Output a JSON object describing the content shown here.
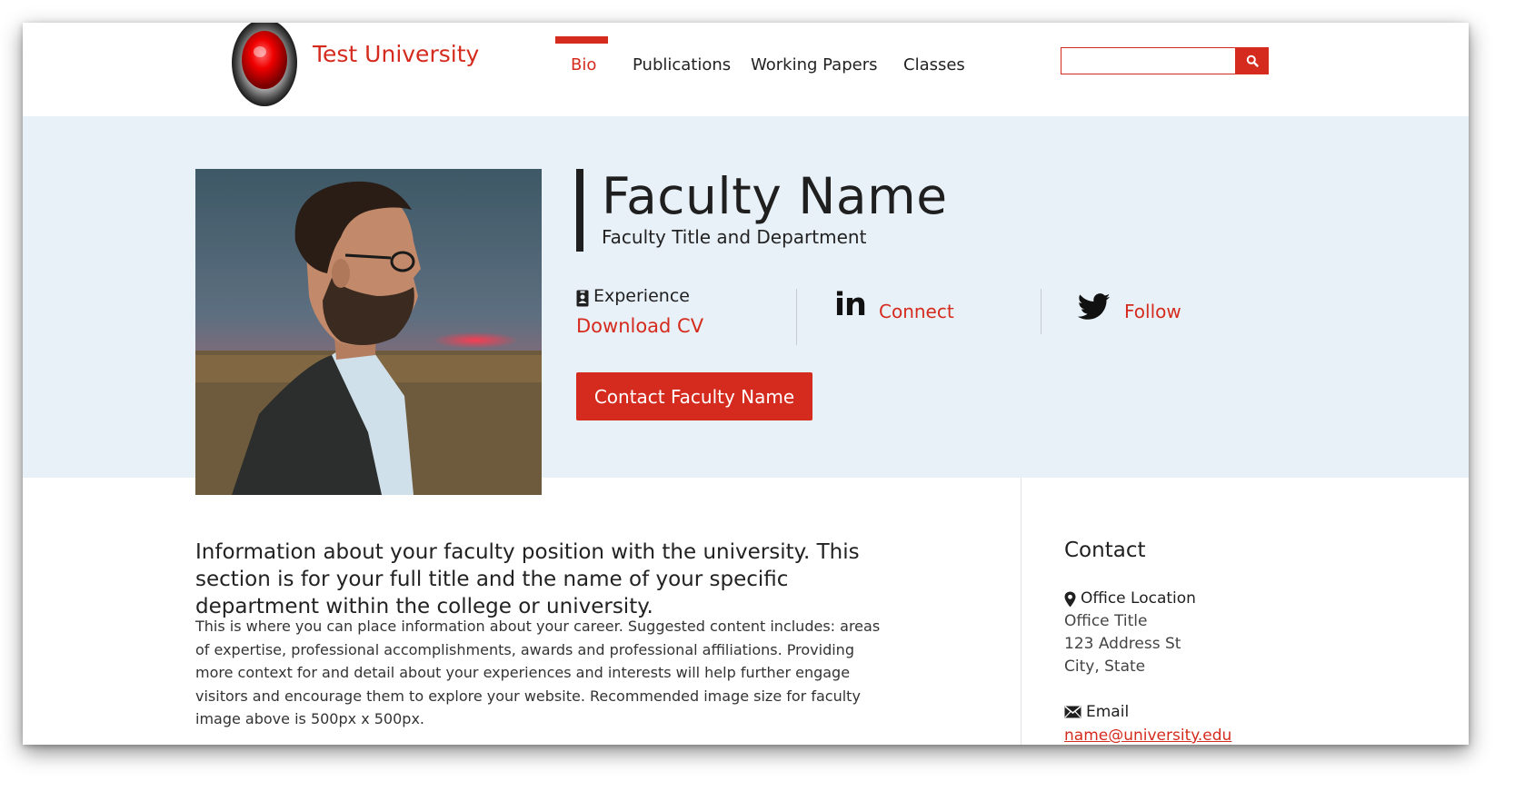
{
  "header": {
    "site_title": "Test University",
    "logo_icon": "red-orb-logo",
    "nav": [
      {
        "label": "Bio",
        "active": true
      },
      {
        "label": "Publications",
        "active": false
      },
      {
        "label": "Working Papers",
        "active": false
      },
      {
        "label": "Classes",
        "active": false
      }
    ],
    "search": {
      "value": "",
      "placeholder": "",
      "button_icon": "search-icon"
    }
  },
  "hero": {
    "photo_alt": "faculty-portrait",
    "name": "Faculty Name",
    "title": "Faculty Title and Department",
    "experience": {
      "icon": "id-badge-icon",
      "label": "Experience",
      "link": "Download CV"
    },
    "linkedin": {
      "icon": "linkedin-icon",
      "icon_text": "in",
      "link": "Connect"
    },
    "twitter": {
      "icon": "twitter-icon",
      "link": "Follow"
    },
    "contact_button": "Contact Faculty Name"
  },
  "main": {
    "lead": "Information about your faculty position with the university. This section is for your full title and the name of your specific department within the college or university.",
    "bio": "This is where you can place information about your career. Suggested content includes: areas of expertise, professional accomplishments, awards and professional affiliations. Providing more context for and detail about your experiences and interests will help further engage visitors and encourage them to explore your website. Recommended image size for faculty image above is 500px x 500px."
  },
  "sidebar": {
    "heading": "Contact",
    "office": {
      "icon": "map-pin-icon",
      "label": "Office Location",
      "lines": [
        "Office Title",
        "123 Address St",
        "City, State"
      ]
    },
    "email": {
      "icon": "envelope-icon",
      "label": "Email",
      "address": "name@university.edu"
    }
  },
  "colors": {
    "accent": "#d52b1e",
    "hero_bg": "#e9f1f8",
    "text": "#1f1f1f"
  }
}
